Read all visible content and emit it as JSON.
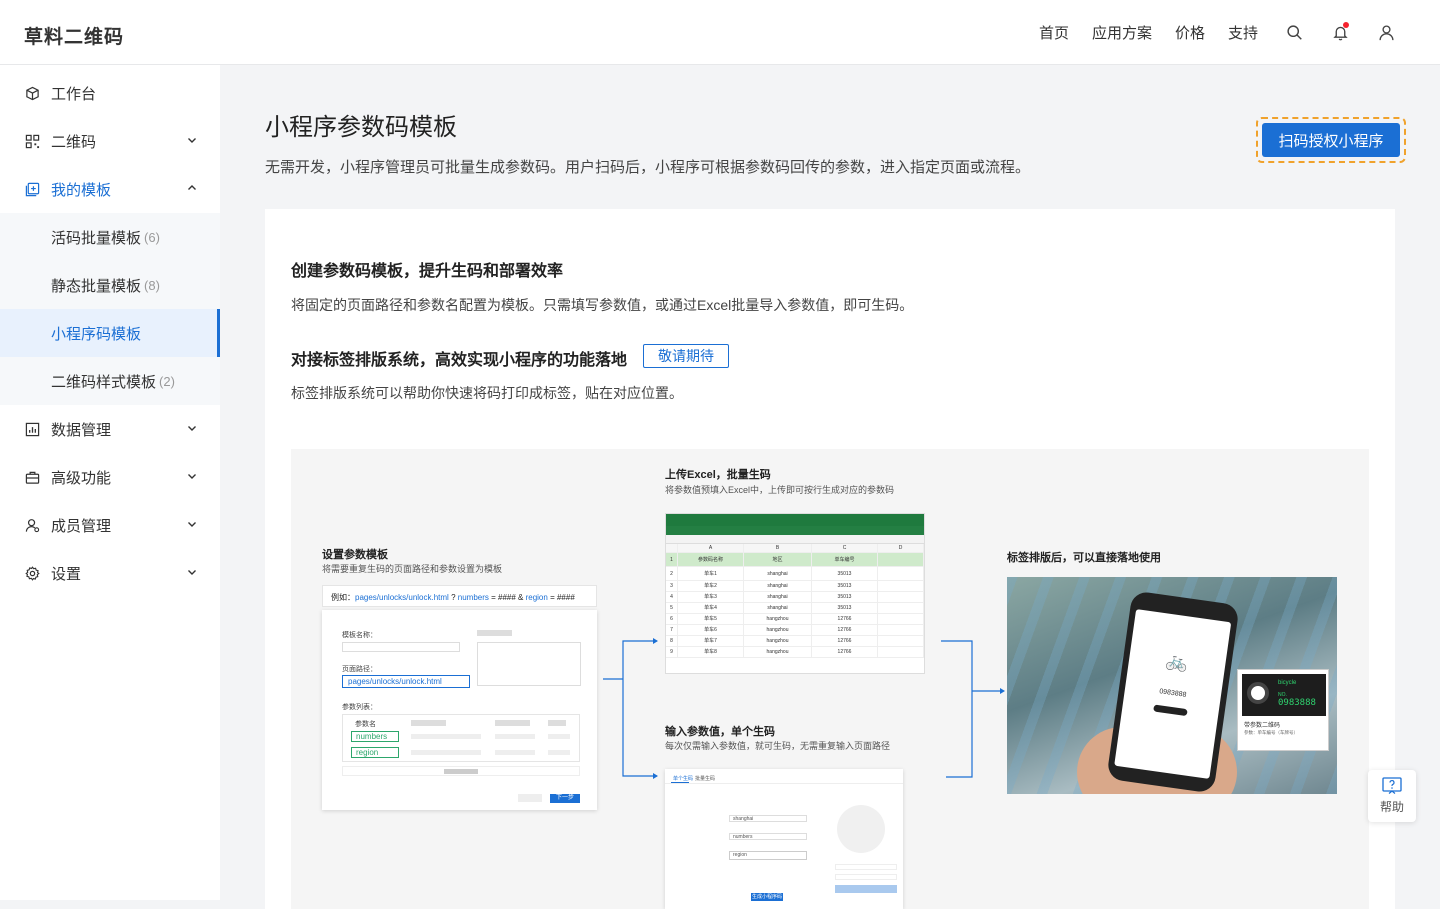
{
  "brand": "草料二维码",
  "topnav": {
    "links": [
      "首页",
      "应用方案",
      "价格",
      "支持"
    ],
    "icons": [
      "search-icon",
      "bell-icon",
      "user-icon"
    ]
  },
  "sidebar": {
    "items": [
      {
        "label": "工作台",
        "icon": "cube-icon"
      },
      {
        "label": "二维码",
        "icon": "qrcode-icon"
      },
      {
        "label": "我的模板",
        "icon": "template-icon",
        "expanded": true
      },
      {
        "label": "数据管理",
        "icon": "chart-icon"
      },
      {
        "label": "高级功能",
        "icon": "briefcase-icon"
      },
      {
        "label": "成员管理",
        "icon": "member-icon"
      },
      {
        "label": "设置",
        "icon": "gear-icon"
      }
    ],
    "sub_items": [
      {
        "label": "活码批量模板",
        "count": "(6)"
      },
      {
        "label": "静态批量模板",
        "count": "(8)"
      },
      {
        "label": "小程序码模板",
        "count": ""
      },
      {
        "label": "二维码样式模板",
        "count": "(2)"
      }
    ]
  },
  "main": {
    "title": "小程序参数码模板",
    "description": "无需开发，小程序管理员可批量生成参数码。用户扫码后，小程序可根据参数码回传的参数，进入指定页面或流程。",
    "auth_button": "扫码授权小程序",
    "section1_title": "创建参数码模板，提升生码和部署效率",
    "section1_text": "将固定的页面路径和参数名配置为模板。只需填写参数值，或通过Excel批量导入参数值，即可生码。",
    "section2_title": "对接标签排版系统，高效实现小程序的功能落地",
    "section2_tag": "敬请期待",
    "section2_text": "标签排版系统可以帮助你快速将码打印成标签，贴在对应位置。"
  },
  "diagram": {
    "step1_title": "设置参数模板",
    "step1_desc": "将需要重复生码的页面路径和参数设置为模板",
    "step1_example_prefix": "例如：",
    "step1_example_path": "pages/unlocks/unlock.html",
    "step1_example_q": "?",
    "step1_example_p1": "numbers",
    "step1_example_eq1": "= #### &",
    "step1_example_p2": "region",
    "step1_example_eq2": "= ####",
    "form_label_name": "模板名称：",
    "form_label_path": "页面路径：",
    "form_path_value": "pages/unlocks/unlock.html",
    "form_label_params": "参数列表：",
    "form_param_header": "参数名",
    "form_param1": "numbers",
    "form_param2": "region",
    "form_next": "下一步",
    "step2_title": "上传Excel，批量生码",
    "step2_desc": "将参数值预填入Excel中，上传即可按行生成对应的参数码",
    "excel_cols": [
      "A",
      "B",
      "C",
      "D"
    ],
    "excel_headers": [
      "参数码名称",
      "地区",
      "单车编号"
    ],
    "excel_rows": [
      [
        "单车1",
        "shanghai",
        "35013"
      ],
      [
        "单车2",
        "shanghai",
        "35013"
      ],
      [
        "单车3",
        "shanghai",
        "35013"
      ],
      [
        "单车4",
        "shanghai",
        "35013"
      ],
      [
        "单车5",
        "hangzhou",
        "12766"
      ],
      [
        "单车6",
        "hangzhou",
        "12766"
      ],
      [
        "单车7",
        "hangzhou",
        "12766"
      ],
      [
        "单车8",
        "hangzhou",
        "12766"
      ]
    ],
    "step3_title": "输入参数值，单个生码",
    "step3_desc": "每次仅需输入参数值，就可生码，无需重复输入页面路径",
    "step3_tabs": [
      "单个生码",
      "批量生码"
    ],
    "step3_values": [
      "shanghai",
      "numbers",
      "region"
    ],
    "step3_btn": "生成小程序码",
    "step4_title": "标签排版后，可以直接落地使用",
    "phone_number": "0983888",
    "label_text": "bicycle",
    "label_no": "NO.",
    "label_code": "0983888",
    "label_caption": "带参数二维码",
    "label_sub": "参数：单车编号（车牌号）"
  },
  "help": "帮助",
  "colors": {
    "accent": "#1b6fd4",
    "highlight": "#f0a22c",
    "notify": "#f5222d"
  }
}
